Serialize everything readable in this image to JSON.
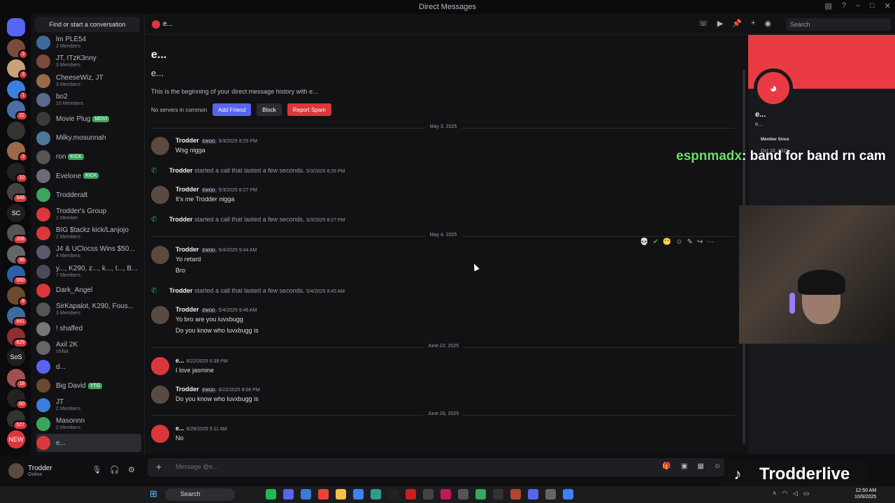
{
  "window": {
    "title": "Direct Messages"
  },
  "servers": [
    {
      "label": "",
      "badge": "",
      "color": "#5865f2"
    },
    {
      "label": "",
      "badge": "3",
      "color": "#7a4b3c"
    },
    {
      "label": "",
      "badge": "3",
      "color": "#c9a27a"
    },
    {
      "label": "",
      "badge": "1",
      "color": "#3d7fe0"
    },
    {
      "label": "",
      "badge": "22",
      "color": "#4a6fa5"
    },
    {
      "label": "",
      "badge": "",
      "color": "#333"
    },
    {
      "label": "",
      "badge": "3",
      "color": "#9b6a4a"
    },
    {
      "label": "",
      "badge": "10",
      "color": "#222"
    },
    {
      "label": "",
      "badge": "548",
      "color": "#444"
    },
    {
      "label": "SC",
      "badge": "",
      "color": "#1e1f22"
    },
    {
      "label": "",
      "badge": "206",
      "color": "#555"
    },
    {
      "label": "",
      "badge": "96",
      "color": "#666"
    },
    {
      "label": "",
      "badge": "550",
      "color": "#2e5fa8"
    },
    {
      "label": "",
      "badge": "8",
      "color": "#6b4a2e"
    },
    {
      "label": "",
      "badge": "641",
      "color": "#3d6b9a"
    },
    {
      "label": "",
      "badge": "829",
      "color": "#8a3030"
    },
    {
      "label": "SoS",
      "badge": "",
      "color": "#1e1f22"
    },
    {
      "label": "",
      "badge": "18",
      "color": "#a05050"
    },
    {
      "label": "",
      "badge": "60",
      "color": "#222"
    },
    {
      "label": "",
      "badge": "527",
      "color": "#333"
    },
    {
      "label": "NEW",
      "badge": "",
      "color": "#da373c"
    }
  ],
  "dm_list": {
    "find_label": "Find or start a conversation",
    "items": [
      {
        "name": "lm PLE54",
        "sub": "2 Members",
        "color": "#3d6b9a",
        "tag": ""
      },
      {
        "name": "JT, ITzK3nny",
        "sub": "3 Members",
        "color": "#7a4b3c",
        "tag": ""
      },
      {
        "name": "CheeseWiz, JT",
        "sub": "3 Members",
        "color": "#9b6a4a",
        "tag": ""
      },
      {
        "name": "bo2",
        "sub": "10 Members",
        "color": "#5a6a8a",
        "tag": ""
      },
      {
        "name": "Movie Plug",
        "sub": "",
        "color": "#3a3a3a",
        "tag": "MOVI"
      },
      {
        "name": "Milky.mosunnah",
        "sub": "",
        "color": "#4a7a9a",
        "tag": ""
      },
      {
        "name": "ron",
        "sub": "",
        "color": "#555",
        "tag": "KICK"
      },
      {
        "name": "Evelone",
        "sub": "",
        "color": "#6a6a7a",
        "tag": "KICK"
      },
      {
        "name": "Trodderalt",
        "sub": "",
        "color": "#3ba55c",
        "tag": ""
      },
      {
        "name": "Trodder's Group",
        "sub": "1 Member",
        "color": "#da373c",
        "tag": ""
      },
      {
        "name": "BIG $tackz kick/Lanjojo",
        "sub": "2 Members",
        "color": "#da373c",
        "tag": ""
      },
      {
        "name": "J4 & UClocss Wins $50...",
        "sub": "4 Members",
        "color": "#5a5a6a",
        "tag": ""
      },
      {
        "name": "y..., K290, z..., k..., t..., B...",
        "sub": "7 Members",
        "color": "#4a4a5a",
        "tag": ""
      },
      {
        "name": "Dark_Angel",
        "sub": "",
        "color": "#da373c",
        "tag": ""
      },
      {
        "name": "SirKapalot, K290, Fous...",
        "sub": "3 Members",
        "color": "#555",
        "tag": ""
      },
      {
        "name": "! shaffed",
        "sub": "",
        "color": "#777",
        "tag": ""
      },
      {
        "name": "Axil 2K",
        "sub": "chillat",
        "color": "#666",
        "tag": ""
      },
      {
        "name": "d...",
        "sub": "",
        "color": "#5865f2",
        "tag": ""
      },
      {
        "name": "Big David",
        "sub": "",
        "color": "#6b4a2e",
        "tag": "YTG"
      },
      {
        "name": "JT",
        "sub": "2 Members",
        "color": "#3d7fe0",
        "tag": ""
      },
      {
        "name": "Masonnn",
        "sub": "2 Members",
        "color": "#3ba55c",
        "tag": ""
      },
      {
        "name": "e...",
        "sub": "",
        "color": "#da373c",
        "tag": ""
      }
    ]
  },
  "user": {
    "name": "Trodder",
    "status": "Online"
  },
  "chat": {
    "header_name": "e...",
    "search_placeholder": "Search",
    "intro_title": "e...",
    "intro_sub": "e...",
    "intro_text": "This is the beginning of your direct message history with e...",
    "no_servers": "No servers in common",
    "add_friend": "Add Friend",
    "block": "Block",
    "report_spam": "Report Spam",
    "composer_placeholder": "Message @e...",
    "dates": {
      "d1": "May 3, 2025",
      "d2": "May 4, 2025",
      "d3": "June 22, 2025",
      "d4": "June 28, 2025"
    },
    "messages": [
      {
        "author": "Trodder",
        "badge": "EMOD",
        "time": "5/3/2025 8:25 PM",
        "lines": [
          "Wsg nigga"
        ]
      },
      {
        "system": true,
        "author": "Trodder",
        "text": "started a call that lasted a few seconds.",
        "time": "5/3/2025 8:26 PM"
      },
      {
        "author": "Trodder",
        "badge": "EMOD",
        "time": "5/3/2025 8:27 PM",
        "lines": [
          "It's me Trodder nigga"
        ]
      },
      {
        "system": true,
        "author": "Trodder",
        "text": "started a call that lasted a few seconds.",
        "time": "5/3/2025 8:27 PM"
      },
      {
        "author": "Trodder",
        "badge": "EMOD",
        "time": "5/4/2025 9:44 AM",
        "lines": [
          "Yo retard",
          "Bro"
        ]
      },
      {
        "system": true,
        "author": "Trodder",
        "text": "started a call that lasted a few seconds.",
        "time": "5/4/2025 9:45 AM"
      },
      {
        "author": "Trodder",
        "badge": "EMOD",
        "time": "5/4/2025 9:46 AM",
        "lines": [
          "Yo bro are you luvxbugg",
          "Do you know who luvxbugg is"
        ]
      },
      {
        "author": "e...",
        "badge": "",
        "time": "6/22/2025 6:39 PM",
        "lines": [
          "I love jasmine"
        ]
      },
      {
        "author": "Trodder",
        "badge": "EMOD",
        "time": "6/22/2025 8:06 PM",
        "lines": [
          "Do you know who luvxbugg is"
        ]
      },
      {
        "author": "e...",
        "badge": "",
        "time": "6/28/2025 5:11 AM",
        "lines": [
          "No"
        ]
      }
    ]
  },
  "profile": {
    "name": "e...",
    "username": "e...",
    "member_since_label": "Member Since",
    "member_since": "Oct 10, 2023"
  },
  "overlay": {
    "user": "espnmadx",
    "text": ": band for band rn cam"
  },
  "tiktok": {
    "name": "Trodderlive"
  },
  "taskbar": {
    "search": "Search",
    "time": "12:50 AM",
    "date": "10/9/2025"
  },
  "colors": {
    "accent": "#5865f2",
    "danger": "#da373c",
    "online": "#23a55a",
    "banner": "#ea3b45"
  }
}
